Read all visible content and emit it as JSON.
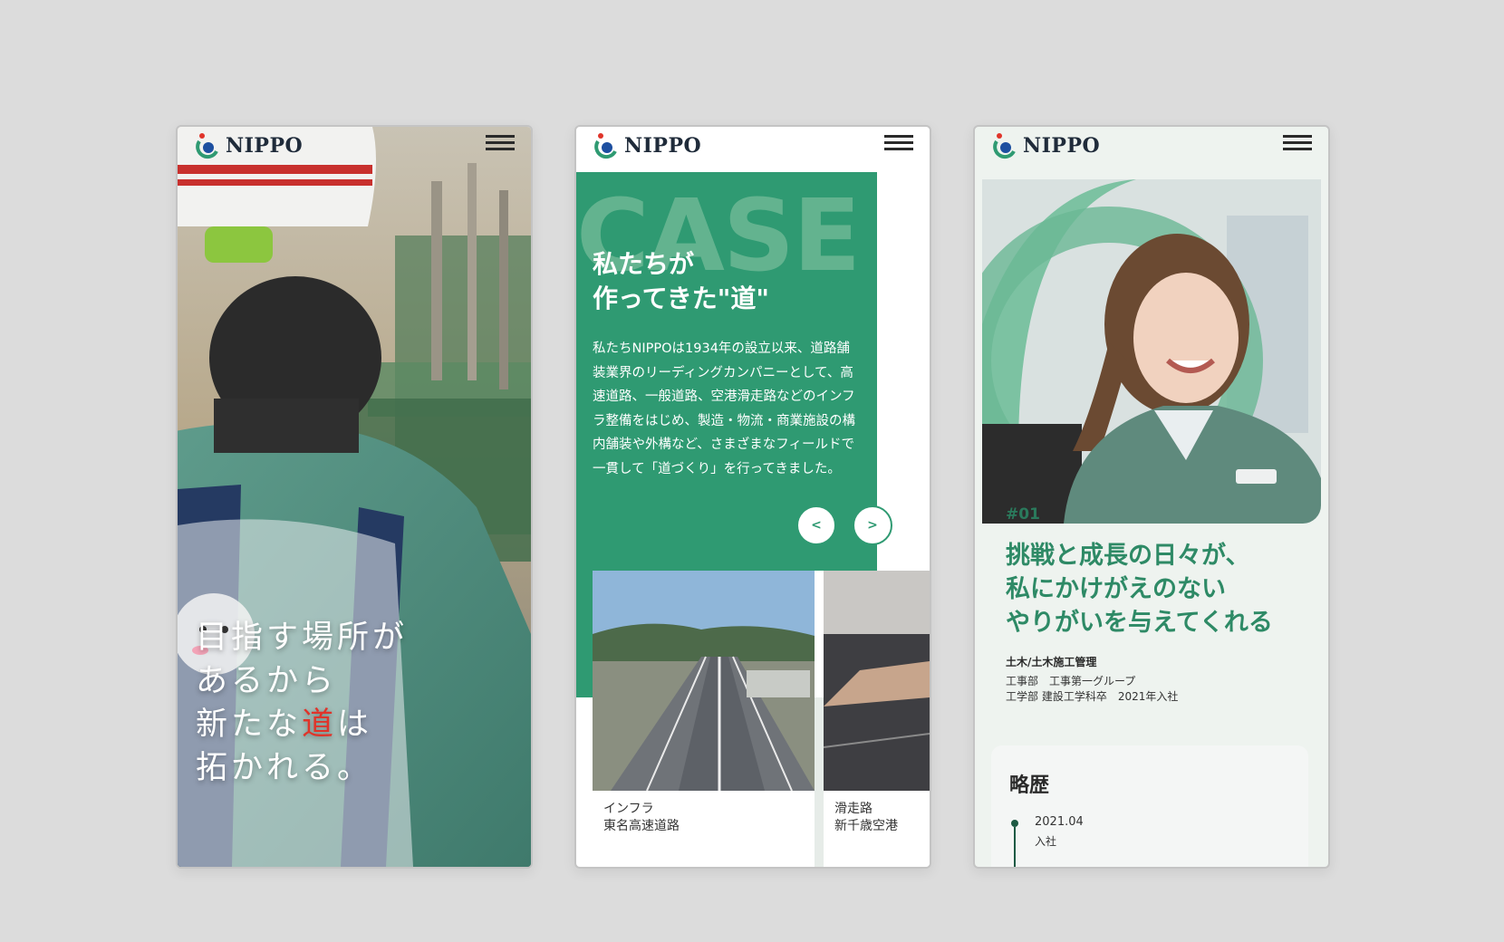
{
  "brand": {
    "name": "NIPPO"
  },
  "colors": {
    "green": "#2f9a72",
    "accent_red": "#e0342a",
    "dark_green": "#2e8a66"
  },
  "icons": {
    "menu": "hamburger-icon",
    "logo": "nippo-logo-mark"
  },
  "screen1": {
    "headline_line1": "目指す場所が",
    "headline_line2": "あるから",
    "headline_line3_a": "新たな",
    "headline_line3_red": "道",
    "headline_line3_b": "は",
    "headline_line4": "拓かれる。"
  },
  "screen2": {
    "bg_word": "CASE",
    "title_line1": "私たちが",
    "title_line2": "作ってきた\"道\"",
    "body": "私たちNIPPOは1934年の設立以来、道路舗装業界のリーディングカンパニーとして、高速道路、一般道路、空港滑走路などのインフラ整備をはじめ、製造・物流・商業施設の構内舗装や外構など、さまざまなフィールドで一貫して「道づくり」を行ってきました。",
    "prev_label": "<",
    "next_label": ">",
    "cards": [
      {
        "category": "インフラ",
        "name": "東名高速道路"
      },
      {
        "category": "滑走路",
        "name": "新千歳空港"
      }
    ]
  },
  "screen3": {
    "number": "#01",
    "headline_line1": "挑戦と成長の日々が、",
    "headline_line2": "私にかけがえのない",
    "headline_line3": "やりがいを与えてくれる",
    "department": "土木/土木施工管理",
    "team": "工事部　工事第一グループ",
    "education": "工学部 建設工学科卒　2021年入社",
    "history_title": "略歴",
    "history": [
      {
        "date": "2021.04",
        "event": "入社"
      }
    ]
  }
}
